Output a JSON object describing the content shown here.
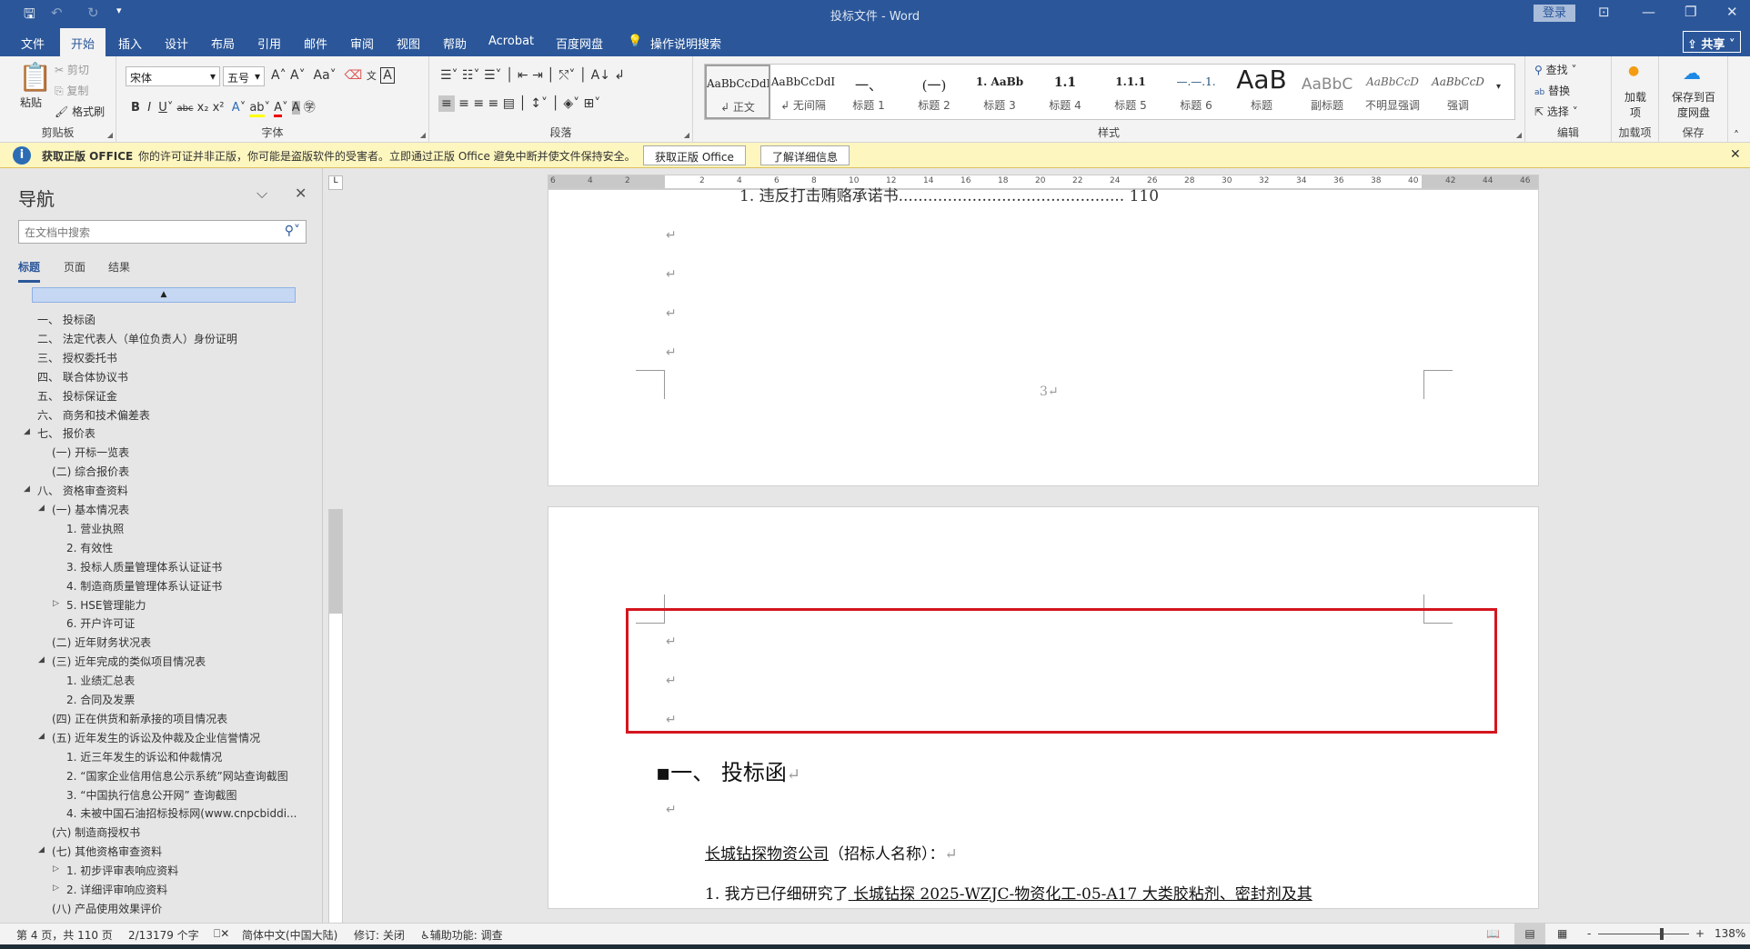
{
  "titlebar": {
    "title": "投标文件 - Word",
    "login": "登录",
    "save_icon": "save-icon",
    "undo_icon": "undo-icon",
    "redo_icon": "redo-icon"
  },
  "tabs": [
    "文件",
    "开始",
    "插入",
    "设计",
    "布局",
    "引用",
    "邮件",
    "审阅",
    "视图",
    "帮助",
    "Acrobat",
    "百度网盘"
  ],
  "tell_me": "操作说明搜索",
  "share": "共享",
  "ribbon": {
    "clipboard": {
      "label": "剪贴板",
      "paste": "粘贴",
      "cut": "剪切",
      "copy": "复制",
      "format_painter": "格式刷"
    },
    "font": {
      "label": "字体",
      "font_name": "宋体",
      "font_size": "五号"
    },
    "paragraph": {
      "label": "段落"
    },
    "styles": {
      "label": "样式",
      "items": [
        {
          "sample": "AaBbCcDdI",
          "name": "↲ 正文"
        },
        {
          "sample": "AaBbCcDdI",
          "name": "↲ 无间隔"
        },
        {
          "sample": "一、",
          "name": "标题 1"
        },
        {
          "sample": "(一)",
          "name": "标题 2"
        },
        {
          "sample": "1. AaBb",
          "name": "标题 3"
        },
        {
          "sample": "1.1",
          "name": "标题 4"
        },
        {
          "sample": "1.1.1",
          "name": "标题 5"
        },
        {
          "sample": "—.—.1.",
          "name": "标题 6"
        },
        {
          "sample": "AaB",
          "name": "标题"
        },
        {
          "sample": "AaBbC",
          "name": "副标题"
        },
        {
          "sample": "AaBbCcD",
          "name": "不明显强调"
        },
        {
          "sample": "AaBbCcD",
          "name": "强调"
        }
      ]
    },
    "editing": {
      "label": "编辑",
      "find": "查找",
      "replace": "替换",
      "select": "选择"
    },
    "addins": {
      "label": "加载项",
      "button": "加载项"
    },
    "save": {
      "label": "保存",
      "button": "保存到百度网盘"
    }
  },
  "infobar": {
    "title": "获取正版 OFFICE",
    "message": "你的许可证并非正版，你可能是盗版软件的受害者。立即通过正版 Office 避免中断并使文件保持安全。",
    "btn1": "获取正版 Office",
    "btn2": "了解详细信息"
  },
  "nav": {
    "title": "导航",
    "search_placeholder": "在文档中搜索",
    "tabs": [
      "标题",
      "页面",
      "结果"
    ],
    "items": [
      {
        "t": "一、 投标函",
        "l": 0
      },
      {
        "t": "二、 法定代表人（单位负责人）身份证明",
        "l": 0
      },
      {
        "t": "三、 授权委托书",
        "l": 0
      },
      {
        "t": "四、 联合体协议书",
        "l": 0
      },
      {
        "t": "五、 投标保证金",
        "l": 0
      },
      {
        "t": "六、 商务和技术偏差表",
        "l": 0
      },
      {
        "t": "七、 报价表",
        "l": 0,
        "e": "open"
      },
      {
        "t": "(一) 开标一览表",
        "l": 1
      },
      {
        "t": "(二) 综合报价表",
        "l": 1
      },
      {
        "t": "八、 资格审查资料",
        "l": 0,
        "e": "open"
      },
      {
        "t": "(一) 基本情况表",
        "l": 1,
        "e": "open"
      },
      {
        "t": "1. 营业执照",
        "l": 2
      },
      {
        "t": "2. 有效性",
        "l": 2
      },
      {
        "t": "3. 投标人质量管理体系认证证书",
        "l": 2
      },
      {
        "t": "4. 制造商质量管理体系认证证书",
        "l": 2
      },
      {
        "t": "5. HSE管理能力",
        "l": 2,
        "e": "closed"
      },
      {
        "t": "6. 开户许可证",
        "l": 2
      },
      {
        "t": "(二) 近年财务状况表",
        "l": 1
      },
      {
        "t": "(三) 近年完成的类似项目情况表",
        "l": 1,
        "e": "open"
      },
      {
        "t": "1. 业绩汇总表",
        "l": 2
      },
      {
        "t": "2. 合同及发票",
        "l": 2
      },
      {
        "t": "(四) 正在供货和新承接的项目情况表",
        "l": 1
      },
      {
        "t": "(五) 近年发生的诉讼及仲裁及企业信誉情况",
        "l": 1,
        "e": "open"
      },
      {
        "t": "1. 近三年发生的诉讼和仲裁情况",
        "l": 2
      },
      {
        "t": "2. “国家企业信用信息公示系统”网站查询截图",
        "l": 2
      },
      {
        "t": "3. “中国执行信息公开网” 查询截图",
        "l": 2
      },
      {
        "t": "4. 未被中国石油招标投标网(www.cnpcbiddi...",
        "l": 2
      },
      {
        "t": "(六) 制造商授权书",
        "l": 1
      },
      {
        "t": "(七) 其他资格审查资料",
        "l": 1,
        "e": "open"
      },
      {
        "t": "1. 初步评审表响应资料",
        "l": 2,
        "e": "closed"
      },
      {
        "t": "2. 详细评审响应资料",
        "l": 2,
        "e": "closed"
      },
      {
        "t": "(八) 产品使用效果评价",
        "l": 1
      }
    ]
  },
  "ruler": [
    "6",
    "4",
    "2",
    "",
    "2",
    "4",
    "6",
    "8",
    "10",
    "12",
    "14",
    "16",
    "18",
    "20",
    "22",
    "24",
    "26",
    "28",
    "30",
    "32",
    "34",
    "36",
    "38",
    "40",
    "42",
    "44",
    "46"
  ],
  "doc": {
    "toc_line": "1.     违反打击贿赂承诺书.............................................. 110",
    "page_number": "3↵",
    "heading": "一、  投标函",
    "recipient": "长城钻探物资公司",
    "recipient_suffix": "（招标人名称）：",
    "line1_prefix": "1. 我方已仔细研究了",
    "line1_underlined": "  长城钻探 2025-WZJC-物资化工-05-A17 大类胶粘剂、密封剂及其"
  },
  "status": {
    "page": "第 4 页，共 110 页",
    "words": "2/13179 个字",
    "language": "简体中文(中国大陆)",
    "track": "修订: 关闭",
    "accessibility": "辅助功能: 调查",
    "zoom": "138%",
    "zoom_percent": 138
  }
}
